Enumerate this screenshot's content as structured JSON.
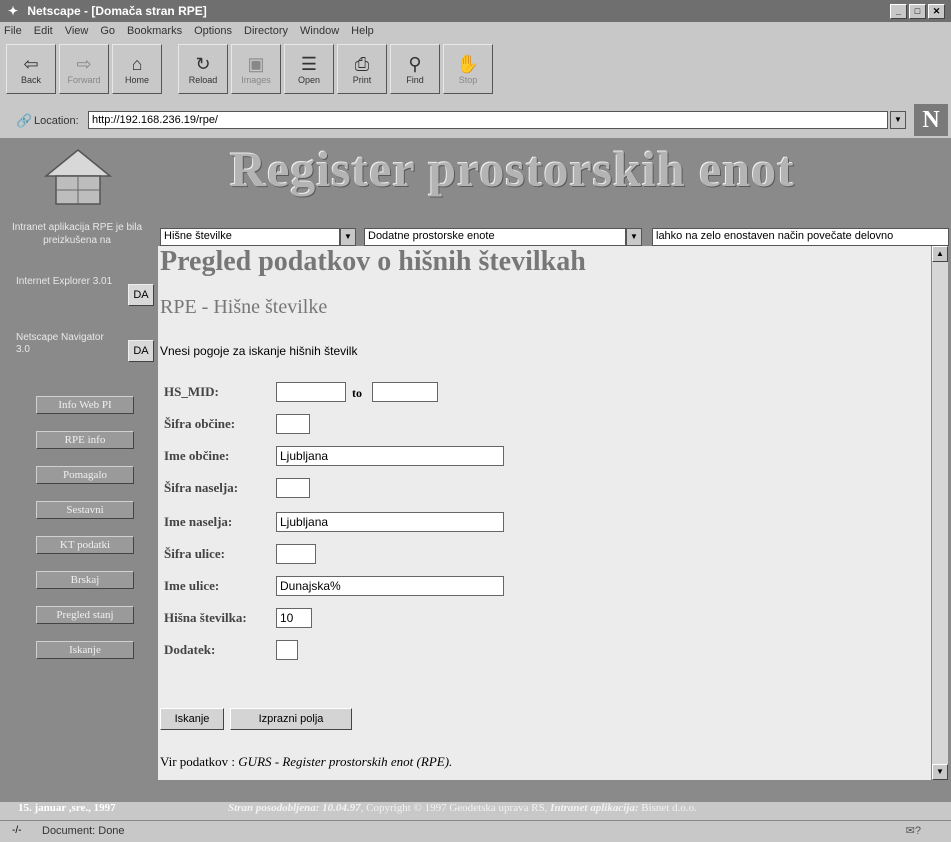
{
  "window": {
    "title": "Netscape - [Domača stran RPE]",
    "controls": [
      "_",
      "□",
      "✕"
    ]
  },
  "menu": [
    "File",
    "Edit",
    "View",
    "Go",
    "Bookmarks",
    "Options",
    "Directory",
    "Window",
    "Help"
  ],
  "toolbar": [
    {
      "label": "Back",
      "icon": "⇦",
      "disabled": false
    },
    {
      "label": "Forward",
      "icon": "⇨",
      "disabled": true
    },
    {
      "label": "Home",
      "icon": "⌂",
      "disabled": false
    },
    {
      "label": "Reload",
      "icon": "↻",
      "disabled": false
    },
    {
      "label": "Images",
      "icon": "▣",
      "disabled": true
    },
    {
      "label": "Open",
      "icon": "☰",
      "disabled": false
    },
    {
      "label": "Print",
      "icon": "⎙",
      "disabled": false
    },
    {
      "label": "Find",
      "icon": "⚲",
      "disabled": false
    },
    {
      "label": "Stop",
      "icon": "✋",
      "disabled": true
    }
  ],
  "location": {
    "label": "Location:",
    "url": "http://192.168.236.19/rpe/"
  },
  "logo_letter": "N",
  "banner": {
    "title": "Register prostorskih enot"
  },
  "sidebar": {
    "note": "Intranet aplikacija RPE je bila preizkušena na",
    "browsers": [
      {
        "name": "Internet Explorer 3.01",
        "badge": "DA"
      },
      {
        "name": "Netscape Navigator 3.0",
        "badge": "DA"
      }
    ],
    "nav": [
      "Info Web PI",
      "RPE info",
      "Pomagalo",
      "Sestavni",
      "KT podatki",
      "Brskaj",
      "Pregled stanj",
      "Iskanje"
    ],
    "date": "15. januar ,sre., 1997"
  },
  "frame_selects": [
    {
      "value": "Hišne številke"
    },
    {
      "value": "Dodatne prostorske enote"
    },
    {
      "value": "lahko na zelo enostaven način povečate delovno"
    }
  ],
  "main": {
    "heading": "Pregled podatkov o hišnih številkah",
    "subheading": "RPE - Hišne številke",
    "intro": "Vnesi pogoje za iskanje hišnih številk",
    "fields": {
      "hs_mid": {
        "label": "HS_MID:",
        "from": "",
        "to_label": "to",
        "to": ""
      },
      "sifra_obcine": {
        "label": "Šifra občine:",
        "value": ""
      },
      "ime_obcine": {
        "label": "Ime občine:",
        "value": "Ljubljana"
      },
      "sifra_naselja": {
        "label": "Šifra naselja:",
        "value": ""
      },
      "ime_naselja": {
        "label": "Ime naselja:",
        "value": "Ljubljana"
      },
      "sifra_ulice": {
        "label": "Šifra ulice:",
        "value": ""
      },
      "ime_ulice": {
        "label": "Ime ulice:",
        "value": "Dunajska%"
      },
      "hisna_stevilka": {
        "label": "Hišna številka:",
        "value": "10"
      },
      "dodatek": {
        "label": "Dodatek:",
        "value": ""
      }
    },
    "buttons": {
      "search": "Iskanje",
      "clear": "Izprazni polja"
    },
    "source_prefix": "Vir podatkov :",
    "source": "GURS - Register prostorskih enot (RPE)."
  },
  "credits": {
    "updated_label": "Stran posodobljena:",
    "updated": "10.04.97",
    "copyright": "Copyright © 1997 Geodetska uprava RS,",
    "app_label": "Intranet aplikacija:",
    "app": "Bisnet d.o.o."
  },
  "status": {
    "icon": "-/-",
    "text": "Document: Done",
    "right": "✉?"
  }
}
